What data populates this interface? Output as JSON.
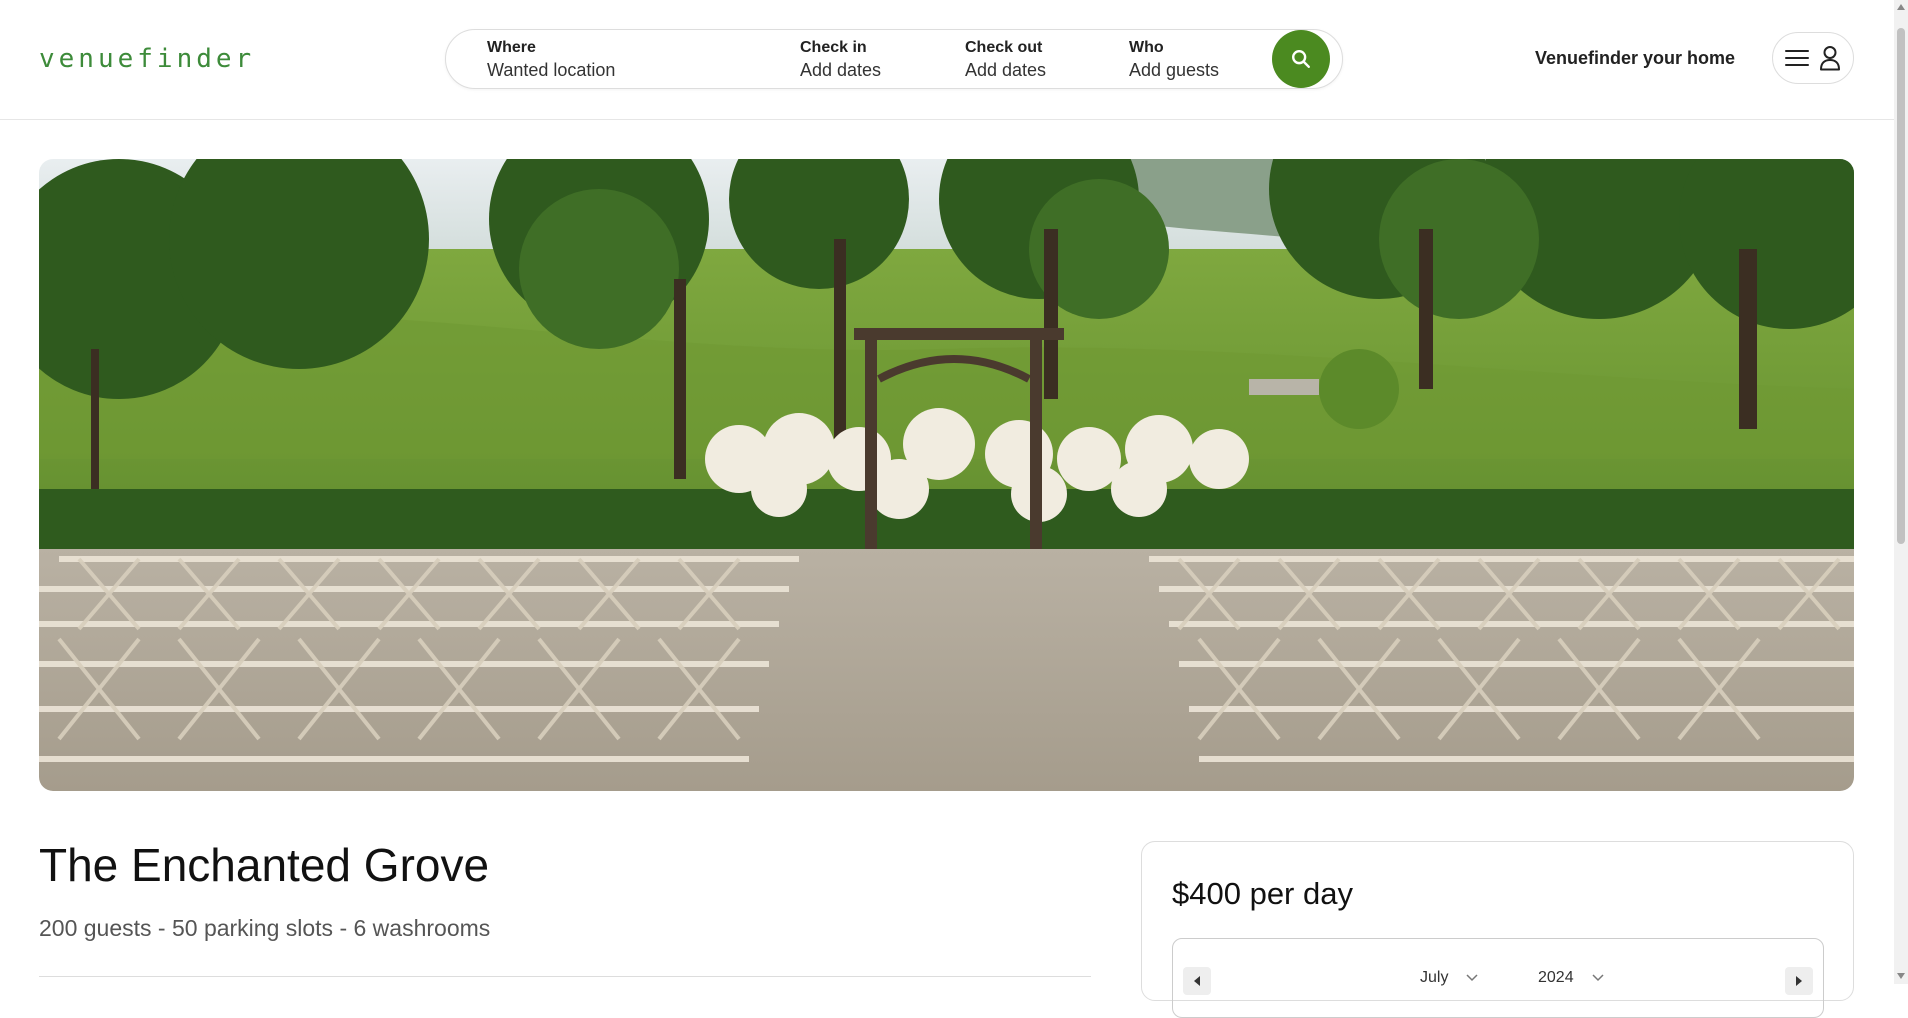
{
  "header": {
    "logo": "venuefinder",
    "host_link": "Venuefinder your home"
  },
  "search": {
    "where_label": "Where",
    "where_value": "Wanted location",
    "checkin_label": "Check in",
    "checkin_value": "Add dates",
    "checkout_label": "Check out",
    "checkout_value": "Add dates",
    "who_label": "Who",
    "who_value": "Add guests",
    "search_icon": "search-icon"
  },
  "user_menu": {
    "menu_icon": "hamburger-icon",
    "user_icon": "user-icon"
  },
  "venue": {
    "title": "The Enchanted Grove",
    "meta": "200 guests - 50 parking slots - 6 washrooms"
  },
  "booking": {
    "price": "$400 per day",
    "month": "July",
    "year": "2024"
  },
  "colors": {
    "brand_green": "#4b8a20",
    "logo_green": "#3d8b3a"
  }
}
